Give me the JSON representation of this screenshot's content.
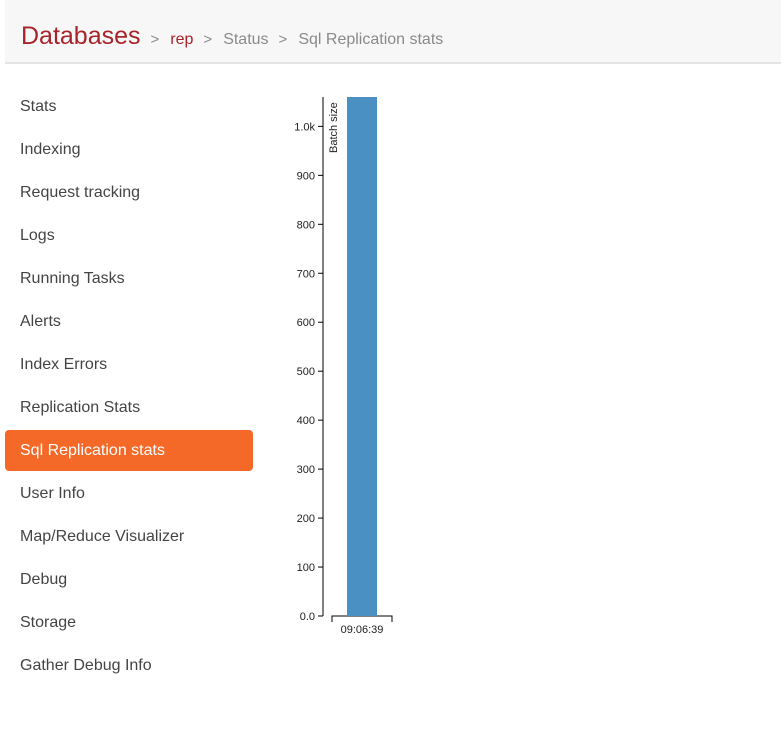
{
  "breadcrumb": {
    "root": "Databases",
    "separator": ">",
    "items": [
      "rep",
      "Status",
      "Sql Replication stats"
    ]
  },
  "sidebar": {
    "items": [
      {
        "label": "Stats"
      },
      {
        "label": "Indexing"
      },
      {
        "label": "Request tracking"
      },
      {
        "label": "Logs"
      },
      {
        "label": "Running Tasks"
      },
      {
        "label": "Alerts"
      },
      {
        "label": "Index Errors"
      },
      {
        "label": "Replication Stats"
      },
      {
        "label": "Sql Replication stats",
        "active": true
      },
      {
        "label": "User Info"
      },
      {
        "label": "Map/Reduce Visualizer"
      },
      {
        "label": "Debug"
      },
      {
        "label": "Storage"
      },
      {
        "label": "Gather Debug Info"
      }
    ]
  },
  "colors": {
    "brand": "#a8232a",
    "active_nav": "#f46927",
    "bar": "#4a90c2"
  },
  "chart_data": {
    "type": "bar",
    "categories": [
      "09:06:39"
    ],
    "values": [
      1060
    ],
    "ylabel": "Batch size",
    "ylim": [
      0,
      1060
    ],
    "yticks": [
      0,
      100,
      200,
      300,
      400,
      500,
      600,
      700,
      800,
      900,
      1000
    ],
    "ytick_labels": [
      "0.0",
      "100",
      "200",
      "300",
      "400",
      "500",
      "600",
      "700",
      "800",
      "900",
      "1.0k"
    ],
    "grid": false
  }
}
